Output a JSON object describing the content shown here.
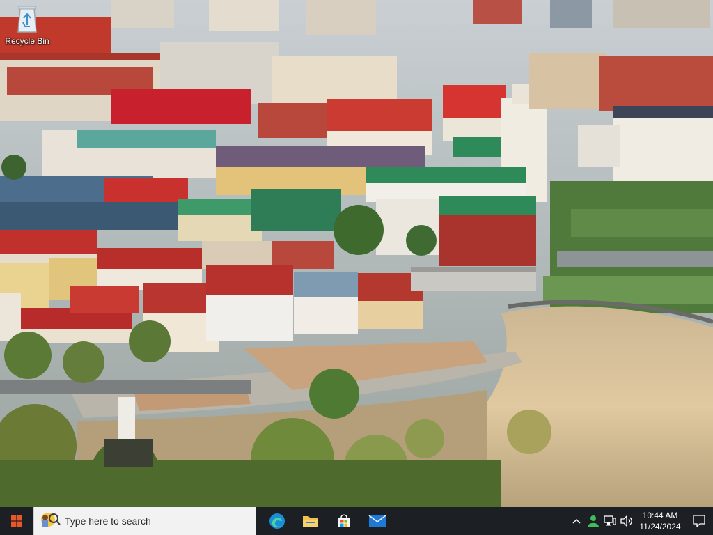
{
  "desktop": {
    "icons": [
      {
        "label": "Recycle Bin",
        "icon": "recycle-bin-icon"
      }
    ]
  },
  "taskbar": {
    "start_icon": "windows-logo-icon",
    "search": {
      "placeholder": "Type here to search",
      "icon": "search-icon"
    },
    "pinned": [
      {
        "name": "edge",
        "icon": "edge-icon"
      },
      {
        "name": "file-explorer",
        "icon": "folder-icon"
      },
      {
        "name": "store",
        "icon": "store-icon"
      },
      {
        "name": "mail",
        "icon": "mail-icon"
      }
    ],
    "tray": {
      "icons": [
        "chevron-up-icon",
        "person-icon",
        "network-icon",
        "volume-icon"
      ],
      "time": "10:44 AM",
      "date": "11/24/2024",
      "notification_icon": "notification-icon"
    }
  },
  "colors": {
    "taskbar": "#1c1f24",
    "search_box": "#f2f2f2",
    "windows_logo": "#e8562a",
    "edge": "#1a8fd6",
    "folder": "#f2c14e",
    "mail": "#1f7ad6"
  }
}
